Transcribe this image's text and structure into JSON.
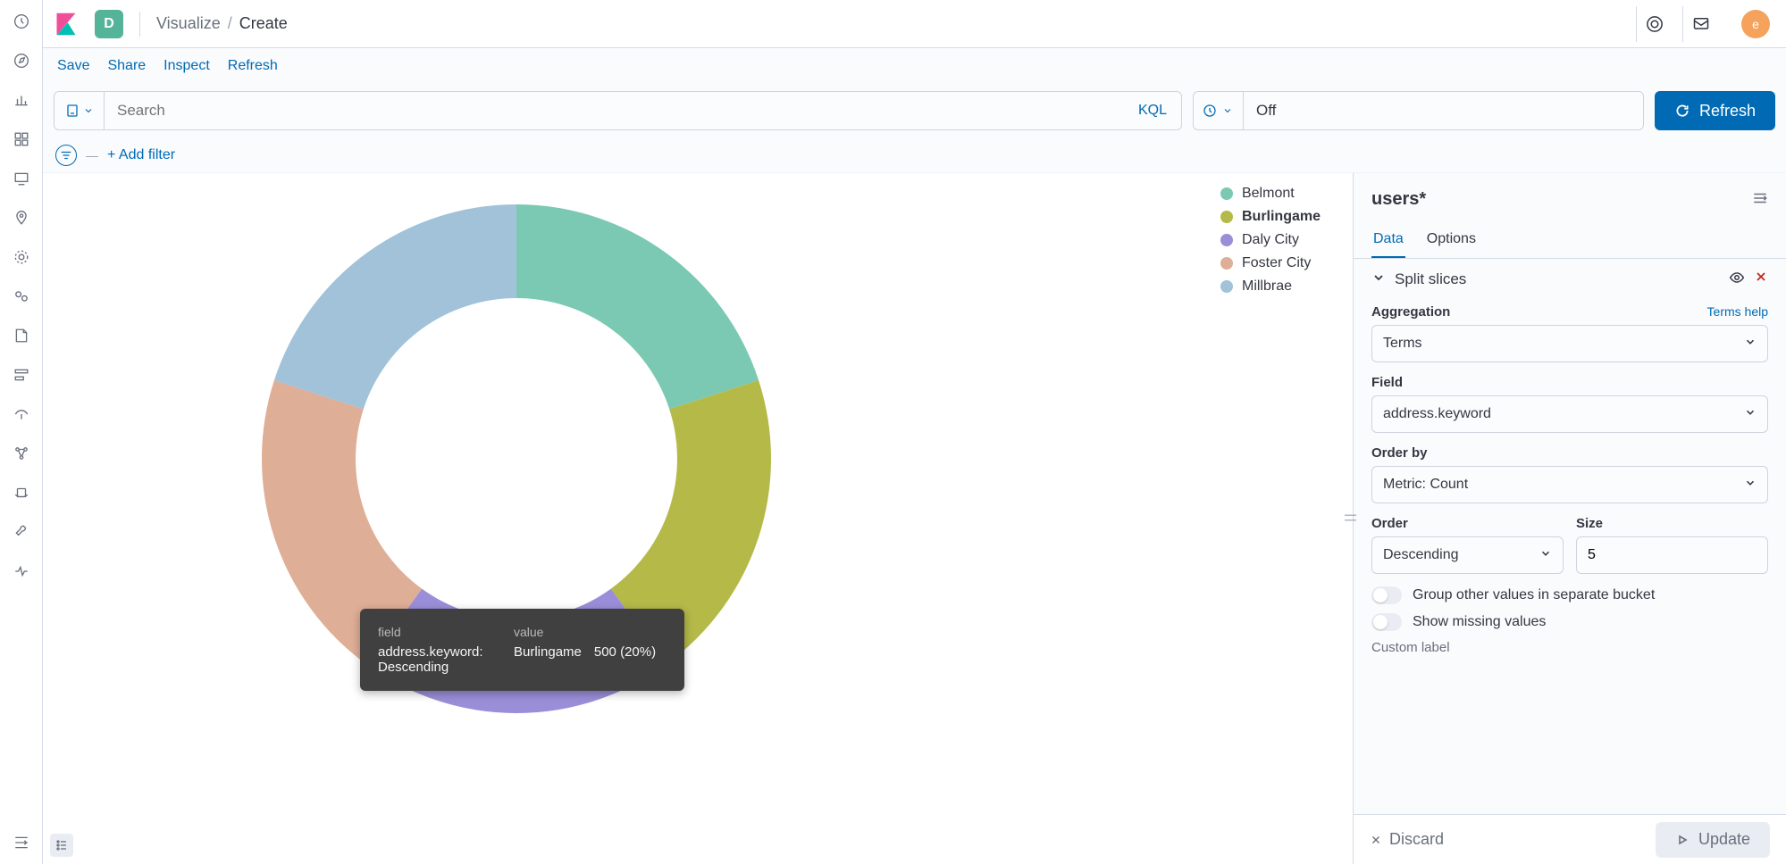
{
  "header": {
    "space_letter": "D",
    "breadcrumb_root": "Visualize",
    "breadcrumb_sep": "/",
    "breadcrumb_current": "Create",
    "avatar_letter": "e"
  },
  "subnav": {
    "save": "Save",
    "share": "Share",
    "inspect": "Inspect",
    "refresh": "Refresh"
  },
  "query": {
    "placeholder": "Search",
    "kql": "KQL",
    "time_value": "Off",
    "refresh_label": "Refresh"
  },
  "filter": {
    "add_filter": "+ Add filter"
  },
  "chart_data": {
    "type": "pie",
    "title": "",
    "slices": [
      {
        "name": "Belmont",
        "value": 500,
        "pct": 20,
        "color": "#7bc9b3"
      },
      {
        "name": "Burlingame",
        "value": 500,
        "pct": 20,
        "color": "#b4b948"
      },
      {
        "name": "Daly City",
        "value": 500,
        "pct": 20,
        "color": "#9a8ed8"
      },
      {
        "name": "Foster City",
        "value": 500,
        "pct": 20,
        "color": "#dfae96"
      },
      {
        "name": "Millbrae",
        "value": 500,
        "pct": 20,
        "color": "#a1c2d9"
      }
    ],
    "tooltip": {
      "head_field": "field",
      "head_value": "value",
      "field": "address.keyword: Descending",
      "value_name": "Burlingame",
      "value_detail": "500 (20%)"
    }
  },
  "panel": {
    "title": "users*",
    "tabs": {
      "data": "Data",
      "options": "Options"
    },
    "section_title": "Split slices",
    "labels": {
      "aggregation": "Aggregation",
      "terms_help": "Terms help",
      "field": "Field",
      "order_by": "Order by",
      "order": "Order",
      "size": "Size",
      "group_other": "Group other values in separate bucket",
      "show_missing": "Show missing values",
      "custom_label": "Custom label"
    },
    "values": {
      "aggregation": "Terms",
      "field": "address.keyword",
      "order_by": "Metric: Count",
      "order": "Descending",
      "size": "5"
    },
    "footer": {
      "discard": "Discard",
      "update": "Update"
    }
  }
}
